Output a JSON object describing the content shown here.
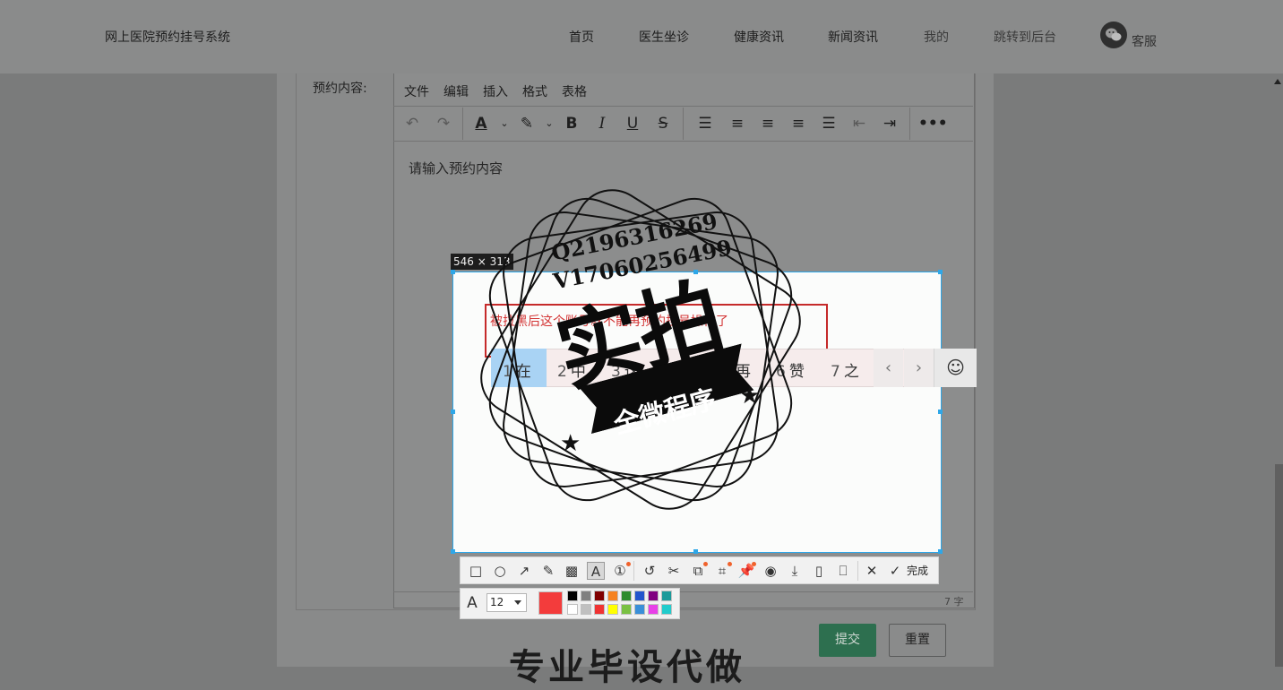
{
  "header": {
    "site_title": "网上医院预约挂号系统",
    "nav": [
      {
        "label": "首页"
      },
      {
        "label": "医生坐诊"
      },
      {
        "label": "健康资讯"
      },
      {
        "label": "新闻资讯"
      },
      {
        "label": "我的"
      },
      {
        "label": "跳转到后台"
      }
    ],
    "support_label": "客服"
  },
  "form": {
    "label": "预约内容:",
    "editor": {
      "menu": [
        "文件",
        "编辑",
        "插入",
        "格式",
        "表格"
      ],
      "toolbar_icons": [
        "undo-icon",
        "redo-icon",
        "font-color-icon",
        "highlight-icon",
        "bold-icon",
        "italic-icon",
        "underline-icon",
        "strikethrough-icon",
        "line-height-icon",
        "align-left-icon",
        "align-center-icon",
        "align-right-icon",
        "justify-icon",
        "outdent-icon",
        "indent-icon",
        "more-icon"
      ],
      "placeholder": "请输入预约内容",
      "word_count": "7 字"
    },
    "submit_label": "提交",
    "reset_label": "重置"
  },
  "bottom_banner": "专业毕设代做",
  "capture": {
    "size_label": "546 × 313",
    "red_text": "被拉黑后这个账号就不能再预约挂号操作了",
    "ime_candidates": [
      {
        "num": "1",
        "text": "在"
      },
      {
        "num": "2",
        "text": "中"
      },
      {
        "num": "3",
        "text": "这"
      },
      {
        "num": "4",
        "text": "做"
      },
      {
        "num": "5",
        "text": "再"
      },
      {
        "num": "6",
        "text": "赞"
      },
      {
        "num": "7",
        "text": "之"
      }
    ],
    "tools": [
      "rectangle-icon",
      "ellipse-icon",
      "arrow-icon",
      "pen-icon",
      "mosaic-icon",
      "text-icon",
      "number-icon",
      "undo-icon",
      "cut-icon",
      "translate-icon",
      "ocr-icon",
      "pin-icon",
      "record-icon",
      "download-icon",
      "phone-icon",
      "bookmark-icon",
      "close-icon",
      "check-icon"
    ],
    "done_label": "完成",
    "font_size": "12",
    "current_color": "#f33c3c",
    "palette": [
      "#000000",
      "#808080",
      "#800000",
      "#f58220",
      "#2e8b2e",
      "#2255cc",
      "#800080",
      "#1a9a9a",
      "#ffffff",
      "#c0c0c0",
      "#f03333",
      "#ffff00",
      "#7ac143",
      "#3a8fd8",
      "#e840e8",
      "#22cccc"
    ]
  },
  "watermark": {
    "line1": "Q2196316269",
    "line2": "V17060256499",
    "big": "实拍",
    "ribbon": "全微程序"
  }
}
